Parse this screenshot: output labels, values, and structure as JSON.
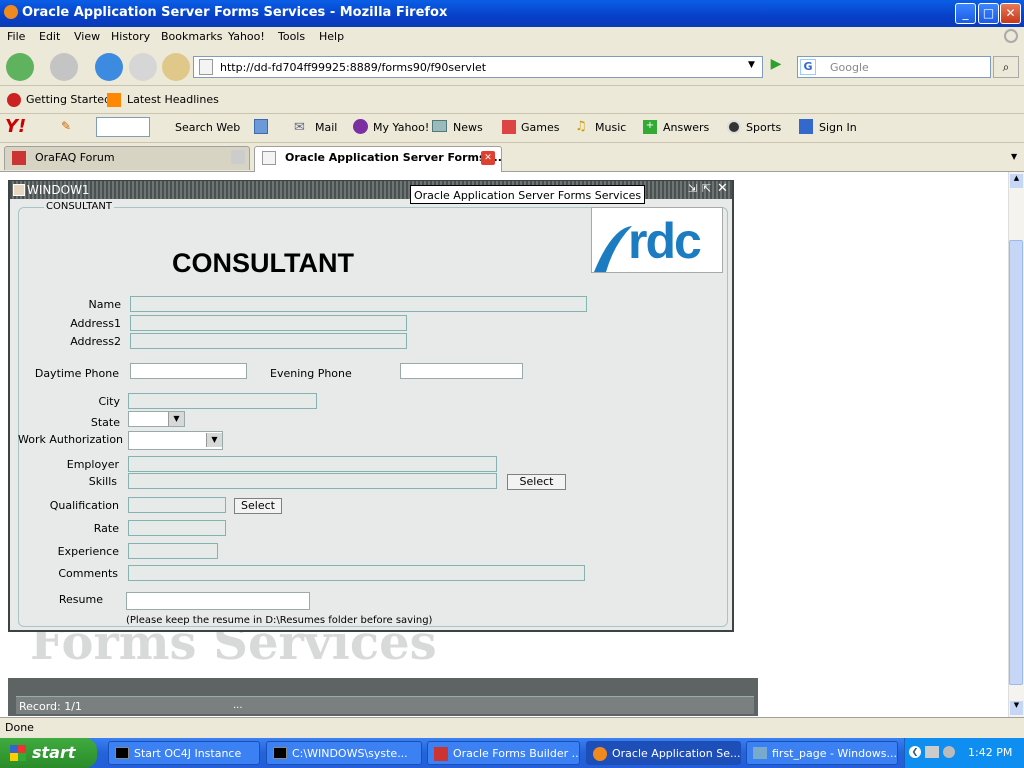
{
  "window": {
    "title": "Oracle Application Server Forms Services - Mozilla Firefox",
    "controls": [
      "_",
      "□",
      "✕"
    ]
  },
  "menu": [
    "File",
    "Edit",
    "View",
    "History",
    "Bookmarks",
    "Yahoo!",
    "Tools",
    "Help"
  ],
  "navbar": {
    "url": "http://dd-fd704ff99925:8889/forms90/f90servlet",
    "search_placeholder": "Google"
  },
  "bookmarks": [
    "Getting Started",
    "Latest Headlines"
  ],
  "yahoo_toolbar": [
    "Search Web",
    "Mail",
    "My Yahoo!",
    "News",
    "Games",
    "Music",
    "Answers",
    "Sports",
    "Sign In"
  ],
  "tabs": [
    {
      "label": "OraFAQ Forum",
      "active": false
    },
    {
      "label": "Oracle Application Server Forms ...",
      "active": true
    }
  ],
  "forms_window": {
    "title": "WINDOW1",
    "tooltip": "Oracle Application Server Forms Services",
    "frame_label": "CONSULTANT",
    "heading": "CONSULTANT",
    "logo_text": "rdc",
    "fields": {
      "name": "Name",
      "address1": "Address1",
      "address2": "Address2",
      "daytime_phone": "Daytime Phone",
      "evening_phone": "Evening Phone",
      "city": "City",
      "state": "State",
      "work_authorization": "Work Authorization",
      "employer": "Employer",
      "skills": "Skills",
      "qualification": "Qualification",
      "rate": "Rate",
      "experience": "Experience",
      "comments": "Comments",
      "resume": "Resume"
    },
    "select_label": "Select",
    "resume_note": "(Please keep the resume in D:\\Resumes folder before saving)",
    "background_text": "Forms Services"
  },
  "forms_status": {
    "record": "Record: 1/1",
    "ellipsis": "..."
  },
  "status_bar": "Done",
  "taskbar": {
    "start": "start",
    "tasks": [
      {
        "label": "Start OC4J Instance",
        "active": false
      },
      {
        "label": "C:\\WINDOWS\\syste...",
        "active": false
      },
      {
        "label": "Oracle Forms Builder ...",
        "active": false
      },
      {
        "label": "Oracle Application Se...",
        "active": true
      },
      {
        "label": "first_page - Windows...",
        "active": false
      }
    ],
    "clock": "1:42 PM"
  }
}
